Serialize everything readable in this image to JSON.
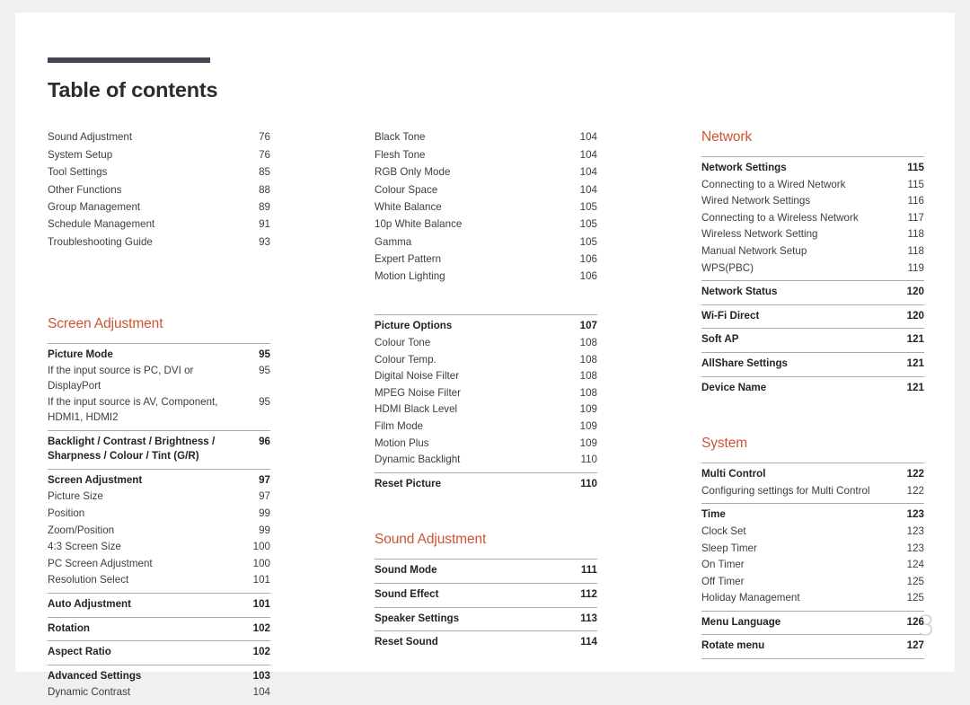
{
  "document": {
    "title": "Table of contents",
    "folio": "3",
    "accent_color": "#cc5533",
    "rule_color": "#45454f"
  },
  "columns": [
    {
      "id": "column-1",
      "blocks": [
        {
          "type": "plain-list",
          "entries": [
            {
              "label": "Sound Adjustment",
              "page": "76",
              "bold": false
            },
            {
              "label": "System Setup",
              "page": "76",
              "bold": false
            },
            {
              "label": "Tool Settings",
              "page": "85",
              "bold": false
            },
            {
              "label": "Other Functions",
              "page": "88",
              "bold": false
            },
            {
              "label": "Group Management",
              "page": "89",
              "bold": false
            },
            {
              "label": "Schedule Management",
              "page": "91",
              "bold": false
            },
            {
              "label": "Troubleshooting Guide",
              "page": "93",
              "bold": false
            }
          ]
        },
        {
          "type": "section",
          "heading": "Screen Adjustment"
        },
        {
          "type": "group",
          "entries": [
            {
              "label": "Picture Mode",
              "page": "95",
              "bold": true
            },
            {
              "label": "If the input source is PC, DVI or DisplayPort",
              "page": "95",
              "bold": false
            },
            {
              "label": "If the input source is AV, Component, HDMI1, HDMI2",
              "page": "95",
              "bold": false
            }
          ]
        },
        {
          "type": "group",
          "entries": [
            {
              "label": "Backlight / Contrast / Brightness / Sharpness / Colour / Tint (G/R)",
              "page": "96",
              "bold": true
            }
          ]
        },
        {
          "type": "group",
          "entries": [
            {
              "label": "Screen Adjustment",
              "page": "97",
              "bold": true
            },
            {
              "label": "Picture Size",
              "page": "97",
              "bold": false
            },
            {
              "label": "Position",
              "page": "99",
              "bold": false
            },
            {
              "label": "Zoom/Position",
              "page": "99",
              "bold": false
            },
            {
              "label": "4:3 Screen Size",
              "page": "100",
              "bold": false
            },
            {
              "label": "PC Screen Adjustment",
              "page": "100",
              "bold": false
            },
            {
              "label": "Resolution Select",
              "page": "101",
              "bold": false
            }
          ]
        },
        {
          "type": "group",
          "entries": [
            {
              "label": "Auto Adjustment",
              "page": "101",
              "bold": true
            }
          ]
        },
        {
          "type": "group",
          "entries": [
            {
              "label": "Rotation",
              "page": "102",
              "bold": true
            }
          ]
        },
        {
          "type": "group",
          "entries": [
            {
              "label": "Aspect Ratio",
              "page": "102",
              "bold": true
            }
          ]
        },
        {
          "type": "group",
          "entries": [
            {
              "label": "Advanced Settings",
              "page": "103",
              "bold": true
            },
            {
              "label": "Dynamic Contrast",
              "page": "104",
              "bold": false
            }
          ]
        }
      ]
    },
    {
      "id": "column-2",
      "blocks": [
        {
          "type": "plain-list",
          "entries": [
            {
              "label": "Black Tone",
              "page": "104",
              "bold": false
            },
            {
              "label": "Flesh Tone",
              "page": "104",
              "bold": false
            },
            {
              "label": "RGB Only Mode",
              "page": "104",
              "bold": false
            },
            {
              "label": "Colour Space",
              "page": "104",
              "bold": false
            },
            {
              "label": "White Balance",
              "page": "105",
              "bold": false
            },
            {
              "label": "10p White Balance",
              "page": "105",
              "bold": false
            },
            {
              "label": "Gamma",
              "page": "105",
              "bold": false
            },
            {
              "label": "Expert Pattern",
              "page": "106",
              "bold": false
            },
            {
              "label": "Motion Lighting",
              "page": "106",
              "bold": false
            }
          ]
        },
        {
          "type": "group",
          "entries": [
            {
              "label": "Picture Options",
              "page": "107",
              "bold": true
            },
            {
              "label": "Colour Tone",
              "page": "108",
              "bold": false
            },
            {
              "label": "Colour Temp.",
              "page": "108",
              "bold": false
            },
            {
              "label": "Digital Noise Filter",
              "page": "108",
              "bold": false
            },
            {
              "label": "MPEG Noise Filter",
              "page": "108",
              "bold": false
            },
            {
              "label": "HDMI Black Level",
              "page": "109",
              "bold": false
            },
            {
              "label": "Film Mode",
              "page": "109",
              "bold": false
            },
            {
              "label": "Motion Plus",
              "page": "109",
              "bold": false
            },
            {
              "label": "Dynamic Backlight",
              "page": "110",
              "bold": false
            }
          ]
        },
        {
          "type": "group",
          "entries": [
            {
              "label": "Reset Picture",
              "page": "110",
              "bold": true
            }
          ]
        },
        {
          "type": "section",
          "heading": "Sound Adjustment"
        },
        {
          "type": "group",
          "entries": [
            {
              "label": "Sound Mode",
              "page": "111",
              "bold": true
            }
          ]
        },
        {
          "type": "group",
          "entries": [
            {
              "label": "Sound Effect",
              "page": "112",
              "bold": true
            }
          ]
        },
        {
          "type": "group",
          "entries": [
            {
              "label": "Speaker Settings",
              "page": "113",
              "bold": true
            }
          ]
        },
        {
          "type": "group",
          "entries": [
            {
              "label": "Reset Sound",
              "page": "114",
              "bold": true
            }
          ]
        }
      ]
    },
    {
      "id": "column-3",
      "blocks": [
        {
          "type": "section",
          "heading": "Network"
        },
        {
          "type": "group",
          "entries": [
            {
              "label": "Network Settings",
              "page": "115",
              "bold": true
            },
            {
              "label": "Connecting to a Wired Network",
              "page": "115",
              "bold": false
            },
            {
              "label": "Wired Network Settings",
              "page": "116",
              "bold": false
            },
            {
              "label": "Connecting to a Wireless Network",
              "page": "117",
              "bold": false
            },
            {
              "label": "Wireless Network Setting",
              "page": "118",
              "bold": false
            },
            {
              "label": "Manual Network Setup",
              "page": "118",
              "bold": false
            },
            {
              "label": "WPS(PBC)",
              "page": "119",
              "bold": false
            }
          ]
        },
        {
          "type": "group",
          "entries": [
            {
              "label": "Network Status",
              "page": "120",
              "bold": true
            }
          ]
        },
        {
          "type": "group",
          "entries": [
            {
              "label": "Wi-Fi Direct",
              "page": "120",
              "bold": true
            }
          ]
        },
        {
          "type": "group",
          "entries": [
            {
              "label": "Soft AP",
              "page": "121",
              "bold": true
            }
          ]
        },
        {
          "type": "group",
          "entries": [
            {
              "label": "AllShare Settings",
              "page": "121",
              "bold": true
            }
          ]
        },
        {
          "type": "group",
          "entries": [
            {
              "label": "Device Name",
              "page": "121",
              "bold": true
            }
          ]
        },
        {
          "type": "section",
          "heading": "System"
        },
        {
          "type": "group",
          "entries": [
            {
              "label": "Multi Control",
              "page": "122",
              "bold": true
            },
            {
              "label": "Configuring settings for Multi Control",
              "page": "122",
              "bold": false
            }
          ]
        },
        {
          "type": "group",
          "entries": [
            {
              "label": "Time",
              "page": "123",
              "bold": true
            },
            {
              "label": "Clock Set",
              "page": "123",
              "bold": false
            },
            {
              "label": "Sleep Timer",
              "page": "123",
              "bold": false
            },
            {
              "label": "On Timer",
              "page": "124",
              "bold": false
            },
            {
              "label": "Off Timer",
              "page": "125",
              "bold": false
            },
            {
              "label": "Holiday Management",
              "page": "125",
              "bold": false
            }
          ]
        },
        {
          "type": "group",
          "entries": [
            {
              "label": "Menu Language",
              "page": "126",
              "bold": true
            }
          ]
        },
        {
          "type": "group",
          "last": true,
          "entries": [
            {
              "label": "Rotate menu",
              "page": "127",
              "bold": true
            }
          ]
        }
      ]
    }
  ]
}
